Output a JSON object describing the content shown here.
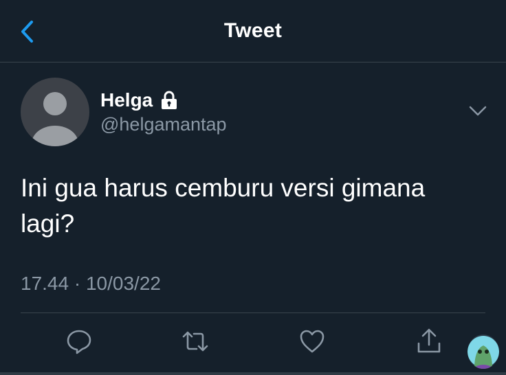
{
  "header": {
    "title": "Tweet"
  },
  "tweet": {
    "author_name": "Helga",
    "author_handle": "@helgamantap",
    "text": "Ini gua harus cemburu versi gimana lagi?",
    "time": "17.44",
    "separator": "·",
    "date": "10/03/22"
  },
  "icons": {
    "back": "chevron-left-icon",
    "lock": "lock-icon",
    "more": "chevron-down-icon",
    "reply": "reply-icon",
    "retweet": "retweet-icon",
    "like": "heart-icon",
    "share": "share-icon"
  },
  "colors": {
    "background": "#15202b",
    "accent": "#1d9bf0",
    "secondary_text": "#8b98a5",
    "divider": "#38444d"
  }
}
